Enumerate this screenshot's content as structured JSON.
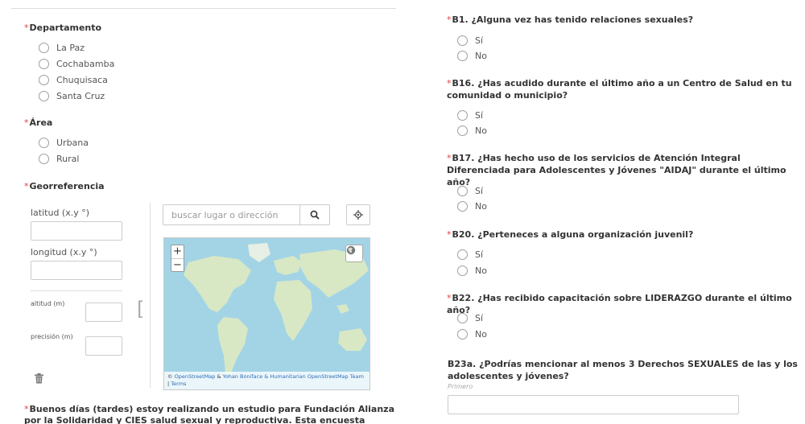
{
  "required_mark": "*",
  "left": {
    "departamento": {
      "label": "Departamento",
      "options": [
        "La Paz",
        "Cochabamba",
        "Chuquisaca",
        "Santa Cruz"
      ]
    },
    "area": {
      "label": "Área",
      "options": [
        "Urbana",
        "Rural"
      ]
    },
    "georreferencia": {
      "label": "Georreferencia",
      "latitud_label": "latitud (x.y °)",
      "longitud_label": "longitud (x.y °)",
      "altitud_label": "altitud (m)",
      "precision_label": "precisión (m)",
      "search_placeholder": "buscar lugar o dirección",
      "zoom_in": "+",
      "zoom_out": "−",
      "attribution": {
        "prefix": "© ",
        "osm": "OpenStreetMap",
        "amp": " & ",
        "credit": "Yohan Boniface & Humanitarian OpenStreetMap Team",
        "sep": " | ",
        "terms": "Terms"
      }
    },
    "intro_text": "Buenos días (tardes) estoy realizando un estudio para Fundación Alianza por la Solidaridad y CIES salud sexual y reproductiva. Esta encuesta contiene preguntas"
  },
  "right": {
    "questions": [
      {
        "label": "B1. ¿Alguna vez has tenido relaciones sexuales?",
        "options": [
          "Sí",
          "No"
        ]
      },
      {
        "label": "B16. ¿Has acudido durante el último año a un Centro de Salud en tu comunidad o municipio?",
        "options": [
          "Sí",
          "No"
        ]
      },
      {
        "label": "B17. ¿Has hecho uso de los servicios de Atención Integral Diferenciada para Adolescentes y Jóvenes \"AIDAJ\" durante el último año?",
        "options": [
          "Sí",
          "No"
        ]
      },
      {
        "label": "B20. ¿Perteneces a alguna organización juvenil?",
        "options": [
          "Sí",
          "No"
        ]
      },
      {
        "label": "B22. ¿Has recibido capacitación sobre LIDERAZGO durante el último año?",
        "options": [
          "Sí",
          "No"
        ]
      }
    ],
    "b23a": {
      "label": "B23a. ¿Podrías mencionar al menos 3 Derechos SEXUALES de las y los adolescentes y jóvenes?",
      "hint": "Primero"
    }
  },
  "colors": {
    "required": "#e0413c",
    "water": "#a3d4e6",
    "land": "#d8e8c4",
    "link": "#2a6bb8"
  },
  "icons": [
    "search-icon",
    "locate-icon",
    "layers-icon",
    "trash-icon"
  ]
}
